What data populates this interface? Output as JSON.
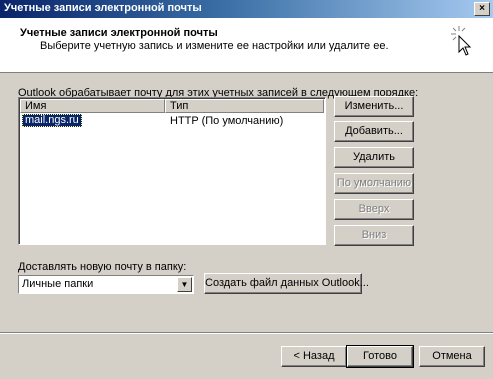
{
  "window": {
    "title": "Учетные записи электронной почты",
    "close_label": "×"
  },
  "header": {
    "title": "Учетные записи электронной почты",
    "subtitle": "Выберите учетную запись и измените ее настройки или удалите ее."
  },
  "accounts": {
    "label": "Outlook обрабатывает почту для этих учетных записей в следующем порядке:",
    "columns": {
      "name": "Имя",
      "type": "Тип"
    },
    "rows": [
      {
        "name": "mail.ngs.ru",
        "type": "HTTP (По умолчанию)"
      }
    ]
  },
  "side_buttons": {
    "change": "Изменить...",
    "add": "Добавить...",
    "remove": "Удалить",
    "default": "По умолчанию",
    "up": "Вверх",
    "down": "Вниз"
  },
  "deliver": {
    "label": "Доставлять новую почту в папку:",
    "selected": "Личные папки",
    "new_file_label": "Создать файл данных Outlook..."
  },
  "footer": {
    "back": "< Назад",
    "finish": "Готово",
    "cancel": "Отмена"
  }
}
